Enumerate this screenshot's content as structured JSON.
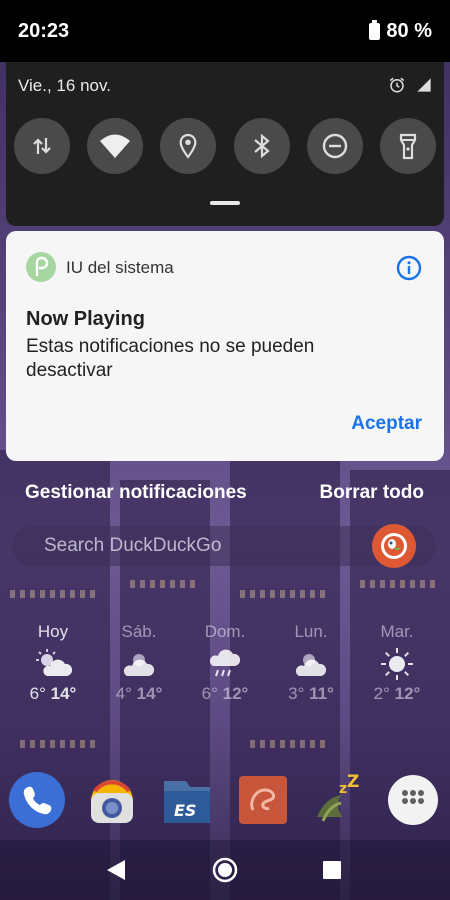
{
  "status_bar": {
    "time": "20:23",
    "battery": "80 %"
  },
  "quick_settings": {
    "date": "Vie., 16 nov.",
    "tiles": [
      {
        "name": "mobile-data",
        "icon": "data-arrows-icon"
      },
      {
        "name": "wifi",
        "icon": "wifi-icon"
      },
      {
        "name": "location",
        "icon": "location-pin-icon"
      },
      {
        "name": "bluetooth",
        "icon": "bluetooth-icon"
      },
      {
        "name": "do-not-disturb",
        "icon": "do-not-disturb-icon"
      },
      {
        "name": "flashlight",
        "icon": "flashlight-icon"
      }
    ]
  },
  "notification": {
    "app_name": "IU del sistema",
    "title": "Now Playing",
    "body": "Estas notificaciones no se pueden desactivar",
    "action": "Aceptar",
    "accent_color": "#1a73e8"
  },
  "footer": {
    "manage": "Gestionar notificaciones",
    "clear": "Borrar todo"
  },
  "search": {
    "placeholder": "Search DuckDuckGo"
  },
  "weather": [
    {
      "day": "Hoy",
      "low": "6°",
      "high": "14°",
      "icon": "partly-cloudy-icon"
    },
    {
      "day": "Sáb.",
      "low": "4°",
      "high": "14°",
      "icon": "partly-cloudy-icon"
    },
    {
      "day": "Dom.",
      "low": "6°",
      "high": "12°",
      "icon": "rain-icon"
    },
    {
      "day": "Lun.",
      "low": "3°",
      "high": "11°",
      "icon": "partly-cloudy-icon"
    },
    {
      "day": "Mar.",
      "low": "2°",
      "high": "12°",
      "icon": "sunny-icon"
    }
  ],
  "dock": [
    "phone-icon",
    "camera-icon",
    "es-file-explorer-icon",
    "app-icon",
    "sleep-app-icon",
    "app-drawer-icon"
  ]
}
